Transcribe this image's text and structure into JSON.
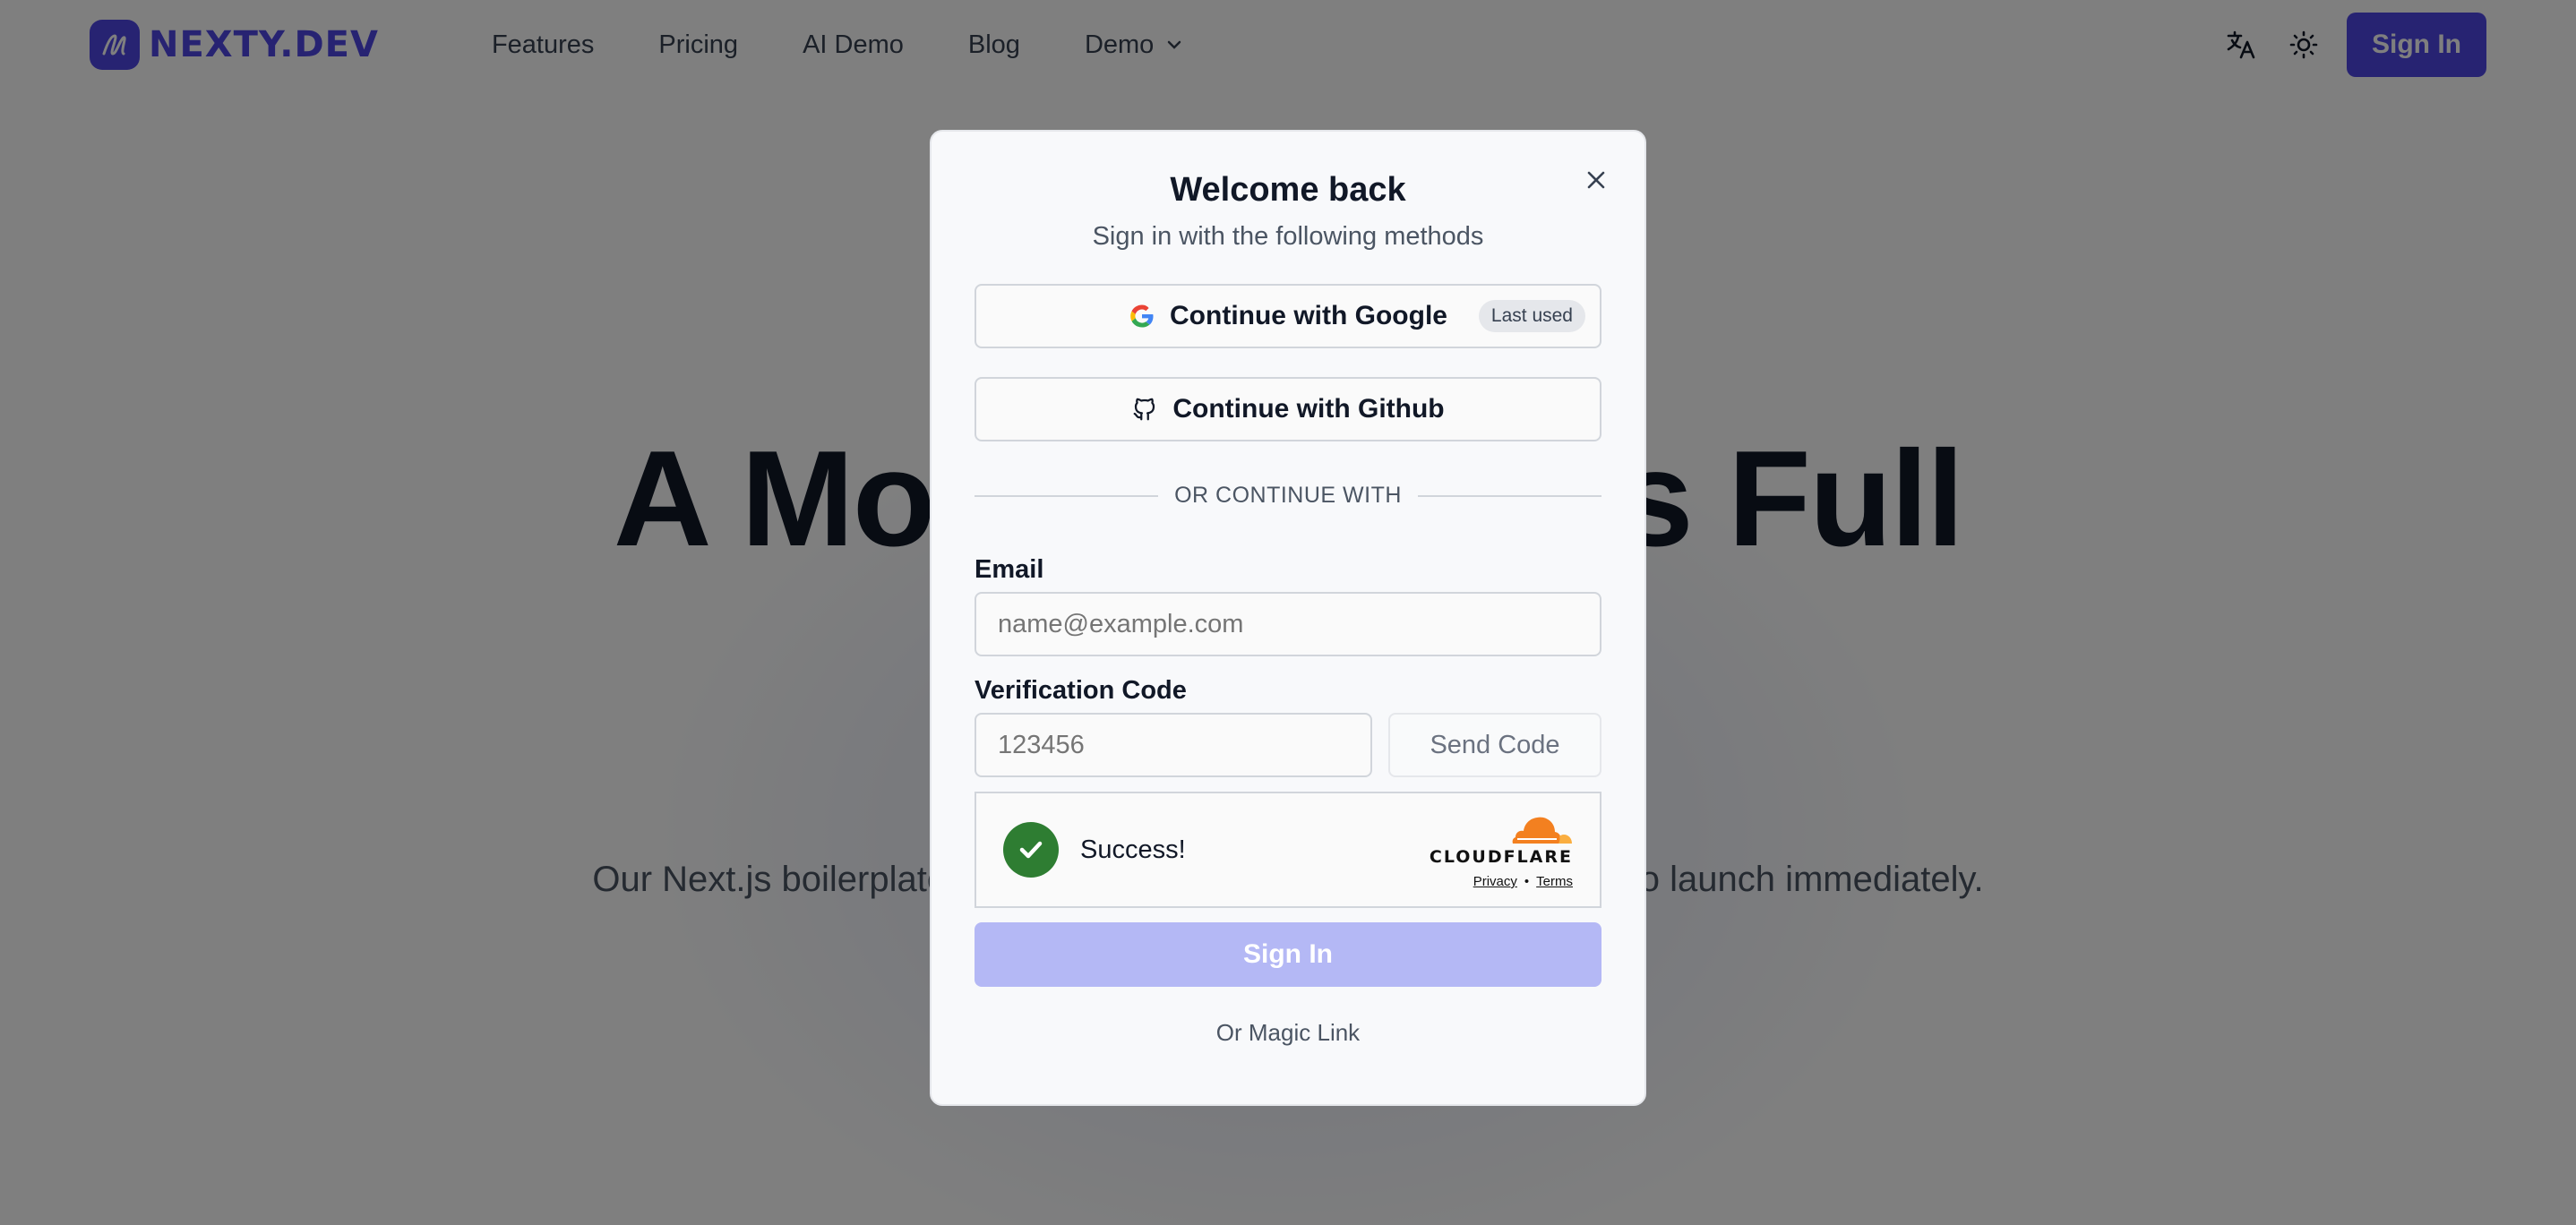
{
  "nav": {
    "brand": "NEXTY.DEV",
    "links": [
      "Features",
      "Pricing",
      "AI Demo",
      "Blog",
      "Demo"
    ],
    "signin_label": "Sign In"
  },
  "hero": {
    "title": "A Modern Next.js Full",
    "subtitle": "Our Next.js boilerplate with AI integration, CMS, and more, ready to launch immediately."
  },
  "modal": {
    "title": "Welcome back",
    "subtitle": "Sign in with the following methods",
    "google_label": "Continue with Google",
    "google_badge": "Last used",
    "github_label": "Continue with Github",
    "divider": "OR CONTINUE WITH",
    "email_label": "Email",
    "email_placeholder": "name@example.com",
    "code_label": "Verification Code",
    "code_placeholder": "123456",
    "send_code": "Send Code",
    "captcha_status": "Success!",
    "captcha_brand": "CLOUDFLARE",
    "captcha_privacy": "Privacy",
    "captcha_sep": "•",
    "captcha_terms": "Terms",
    "signin_button": "Sign In",
    "magic_link": "Or Magic Link"
  },
  "colors": {
    "brand": "#4f46e5",
    "overlay": "rgba(0,0,0,0.5)",
    "success": "#2e7d32",
    "cloudflare": "#f38020"
  }
}
